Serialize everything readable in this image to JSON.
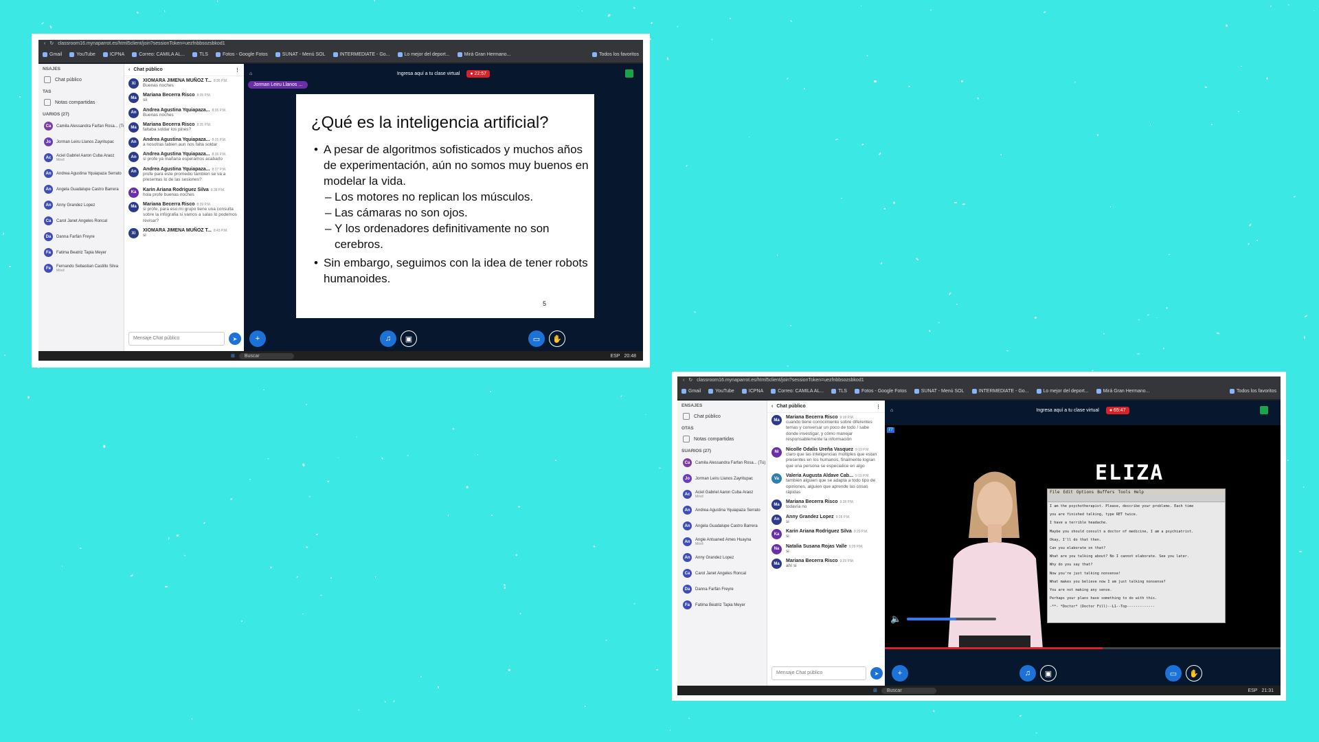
{
  "shot1": {
    "url": "classroom16.mynaparrot.es/html5client/join?sessionToken=uezfnbbsozsbkod1",
    "bookmarks": [
      "Gmail",
      "YouTube",
      "ICPNA",
      "Correo: CAMILA AL...",
      "TLS",
      "Fotos - Google Fotos",
      "SUNAT - Menú SOL",
      "INTERMEDIATE - Go...",
      "Lo mejor del deport...",
      "Mirá Gran Hermano...",
      "Todos los favoritos"
    ],
    "sidebar": {
      "mensajes_head": "NSAJES",
      "chat_publico": "Chat público",
      "notas_head": "TAS",
      "notas": "Notas compartidas",
      "usuarios_head": "UARIOS (27)",
      "users": [
        {
          "initials": "Ca",
          "name": "Camila Alessandra Farfan Rosa... (Tú)",
          "color": "#7b3fa0"
        },
        {
          "initials": "Jo",
          "name": "Jorman Leiru Llanos Zayritupac",
          "color": "#6a3fb5"
        },
        {
          "initials": "Ac",
          "name": "Aciel Gabriel Aaron Cuba Araoz",
          "sub": "Móvil",
          "color": "#3f4db5"
        },
        {
          "initials": "An",
          "name": "Andrea Agustina Yquiapaza Serrato",
          "color": "#3f4db5"
        },
        {
          "initials": "An",
          "name": "Angela Guadalupe Castro Barrera",
          "color": "#3f4db5"
        },
        {
          "initials": "An",
          "name": "Anny Grandez Lopez",
          "color": "#3f4db5"
        },
        {
          "initials": "Ca",
          "name": "Carol Janet Angeles Roncal",
          "color": "#3f4db5"
        },
        {
          "initials": "Da",
          "name": "Danna Farfán Freyre",
          "color": "#3f4db5"
        },
        {
          "initials": "Fa",
          "name": "Fatima Beatriz Tapia Meyer",
          "color": "#3f4db5"
        },
        {
          "initials": "Fe",
          "name": "Fernando Sebastian Castillo Silva",
          "sub": "Móvil",
          "color": "#3f4db5"
        }
      ]
    },
    "chat": {
      "title": "Chat público",
      "messages": [
        {
          "initials": "Xi",
          "name": "XIOMARA JIMENA MUÑOZ T...",
          "time": "8:35 P.M.",
          "text": "Buenas noches"
        },
        {
          "initials": "Ma",
          "name": "Mariana Becerra Risco",
          "time": "8:35 P.M.",
          "text": "sii"
        },
        {
          "initials": "An",
          "name": "Andrea Agustina Yquiapaza...",
          "time": "8:35 P.M.",
          "text": "Buenas noches"
        },
        {
          "initials": "Ma",
          "name": "Mariana Becerra Risco",
          "time": "8:35 P.M.",
          "text": "faltaba soldar los pines?"
        },
        {
          "initials": "An",
          "name": "Andrea Agustina Yquiapaza...",
          "time": "8:35 P.M.",
          "text": "a nosotras tabien aun nos falta soldar"
        },
        {
          "initials": "An",
          "name": "Andrea Agustina Yquiapaza...",
          "time": "8:36 P.M.",
          "text": "si profe ya mañana esperamos acabarlo"
        },
        {
          "initials": "An",
          "name": "Andrea Agustina Yquiapaza...",
          "time": "8:37 P.M.",
          "text": "profe para este promedio tambien se va a presentas lo de las sesiones?"
        },
        {
          "initials": "Ka",
          "name": "Karin Ariana Rodriguez Silva",
          "time": "8:38 P.M.",
          "text": "hola profe buenas noches"
        },
        {
          "initials": "Ma",
          "name": "Mariana Becerra Risco",
          "time": "8:39 P.M.",
          "text": "si profe, para eso mi grupo tiene una consulta sobre la infografia si vamos a salas lo podemos revisar?"
        },
        {
          "initials": "Xi",
          "name": "XIOMARA JIMENA MUÑOZ T...",
          "time": "8:43 P.M.",
          "text": "si"
        }
      ],
      "input_placeholder": "Mensaje Chat público"
    },
    "meeting": {
      "title": "Ingresa aquí a tu clase virtual",
      "timer": "22:57",
      "presenter": "Jorman Leiru Llanos ..."
    },
    "slide": {
      "title": "¿Qué es la inteligencia artificial?",
      "bullet1": "A pesar de algoritmos sofisticados y muchos años de experimentación, aún no somos muy buenos en modelar la vida.",
      "sub1": "Los motores no replican los músculos.",
      "sub2": "Las cámaras no son ojos.",
      "sub3": "Y los ordenadores definitivamente no son cerebros.",
      "bullet2": "Sin embargo, seguimos con la idea de tener robots humanoides.",
      "page": "5"
    },
    "taskbar": {
      "search": "Buscar",
      "lang": "ESP",
      "time": "20:48"
    }
  },
  "shot2": {
    "url": "classroom16.mynaparrot.es/html5client/join?sessionToken=uezfnbbsozsbkod1",
    "bookmarks": [
      "Gmail",
      "YouTube",
      "ICPNA",
      "Correo: CAMILA AL...",
      "TLS",
      "Fotos - Google Fotos",
      "SUNAT - Menú SOL",
      "INTERMEDIATE - Go...",
      "Lo mejor del deport...",
      "Mirá Gran Hermano...",
      "Todos los favoritos"
    ],
    "sidebar": {
      "mensajes_head": "ENSAJES",
      "chat_publico": "Chat público",
      "notas_head": "OTAS",
      "notas": "Notas compartidas",
      "usuarios_head": "SUARIOS (27)",
      "users": [
        {
          "initials": "Ca",
          "name": "Camila Alessandra Farfan Rosa... (Tú)",
          "color": "#7b3fa0"
        },
        {
          "initials": "Jo",
          "name": "Jorman Leiru Llanos Zayritupac",
          "color": "#6a3fb5"
        },
        {
          "initials": "Ac",
          "name": "Aciel Gabriel Aaron Cuba Araoz",
          "sub": "Móvil",
          "color": "#3f4db5"
        },
        {
          "initials": "An",
          "name": "Andrea Agustina Yquiapaza Serrato",
          "color": "#3f4db5"
        },
        {
          "initials": "An",
          "name": "Angela Guadalupe Castro Barrera",
          "color": "#3f4db5"
        },
        {
          "initials": "An",
          "name": "Angie Antuaned Ames Huayna",
          "sub": "Móvil",
          "color": "#3f4db5"
        },
        {
          "initials": "An",
          "name": "Anny Grandez Lopez",
          "color": "#3f4db5"
        },
        {
          "initials": "Ca",
          "name": "Carol Janet Angeles Roncal",
          "color": "#3f4db5"
        },
        {
          "initials": "Da",
          "name": "Danna Farfán Freyre",
          "color": "#3f4db5"
        },
        {
          "initials": "Fa",
          "name": "Fatima Beatriz Tapia Meyer",
          "color": "#3f4db5"
        }
      ]
    },
    "chat": {
      "title": "Chat público",
      "messages": [
        {
          "initials": "Ma",
          "name": "Mariana Becerra Risco",
          "time": "9:18 P.M.",
          "text": "cuando tiene conocimiento sobre diferentes temas y conversar un poco de todo / sabe donde investigar, y cómo manejar responsablemente la información"
        },
        {
          "initials": "Ni",
          "name": "Nicolle Odalis Ureña Vasquez",
          "time": "9:19 P.M.",
          "text": "claro que las inteligencias múltiples que estan presentes en los humanos, finalmente logran que una persona se especialice en algo"
        },
        {
          "initials": "Va",
          "name": "Valeria Augusta Aldave Cab...",
          "time": "9:19 P.M.",
          "text": "también alguien que se adapta a todo tipo de opiniones, alguien que aprende las cosas rápidas"
        },
        {
          "initials": "Ma",
          "name": "Mariana Becerra Risco",
          "time": "9:28 P.M.",
          "text": "todavía no"
        },
        {
          "initials": "An",
          "name": "Anny Grandez Lopez",
          "time": "9:28 P.M.",
          "text": "si"
        },
        {
          "initials": "Ka",
          "name": "Karin Ariana Rodriguez Silva",
          "time": "9:29 P.M.",
          "text": "si"
        },
        {
          "initials": "Na",
          "name": "Natalia Susana Rojas Valle",
          "time": "9:29 P.M.",
          "text": "si"
        },
        {
          "initials": "Ma",
          "name": "Mariana Becerra Risco",
          "time": "9:29 P.M.",
          "text": "ahí si"
        }
      ],
      "input_placeholder": "Mensaje Chat público"
    },
    "meeting": {
      "title": "Ingresa aquí a tu clase virtual",
      "timer": "65:47"
    },
    "video": {
      "logo": "ELIZA",
      "badge": "77",
      "menu": [
        "File",
        "Edit",
        "Options",
        "Buffers",
        "Tools",
        "Help"
      ],
      "lines": [
        "I am the psychotherapist.  Please, describe your problems.  Each time",
        "you are finished talking, type RET twice.",
        "I have a terrible headache.",
        "Maybe you should consult a doctor of medicine, I am a psychiatrist.",
        "Okay, I'll do that then.",
        "Can you elaborate on that?",
        "What are you talking about? No I cannot elaborate. See you later.",
        "Why do you say that?",
        "Now you're just talking nonsense!",
        "What makes you believe now I am just talking nonsense?",
        "You are not making any sense.",
        "Perhaps your plans have something to do with this.",
        "-**- *Doctor*      (Doctor Fill)--L1--Top-------------"
      ],
      "volume_fraction": 0.55,
      "progress_fraction": 0.55
    },
    "taskbar": {
      "search": "Buscar",
      "lang": "ESP",
      "time": "21:31"
    }
  },
  "colors": {
    "background": "#3ce8e4",
    "accent": "#1d72d8",
    "recording": "#d6232a",
    "meeting_bg": "#06172e"
  }
}
